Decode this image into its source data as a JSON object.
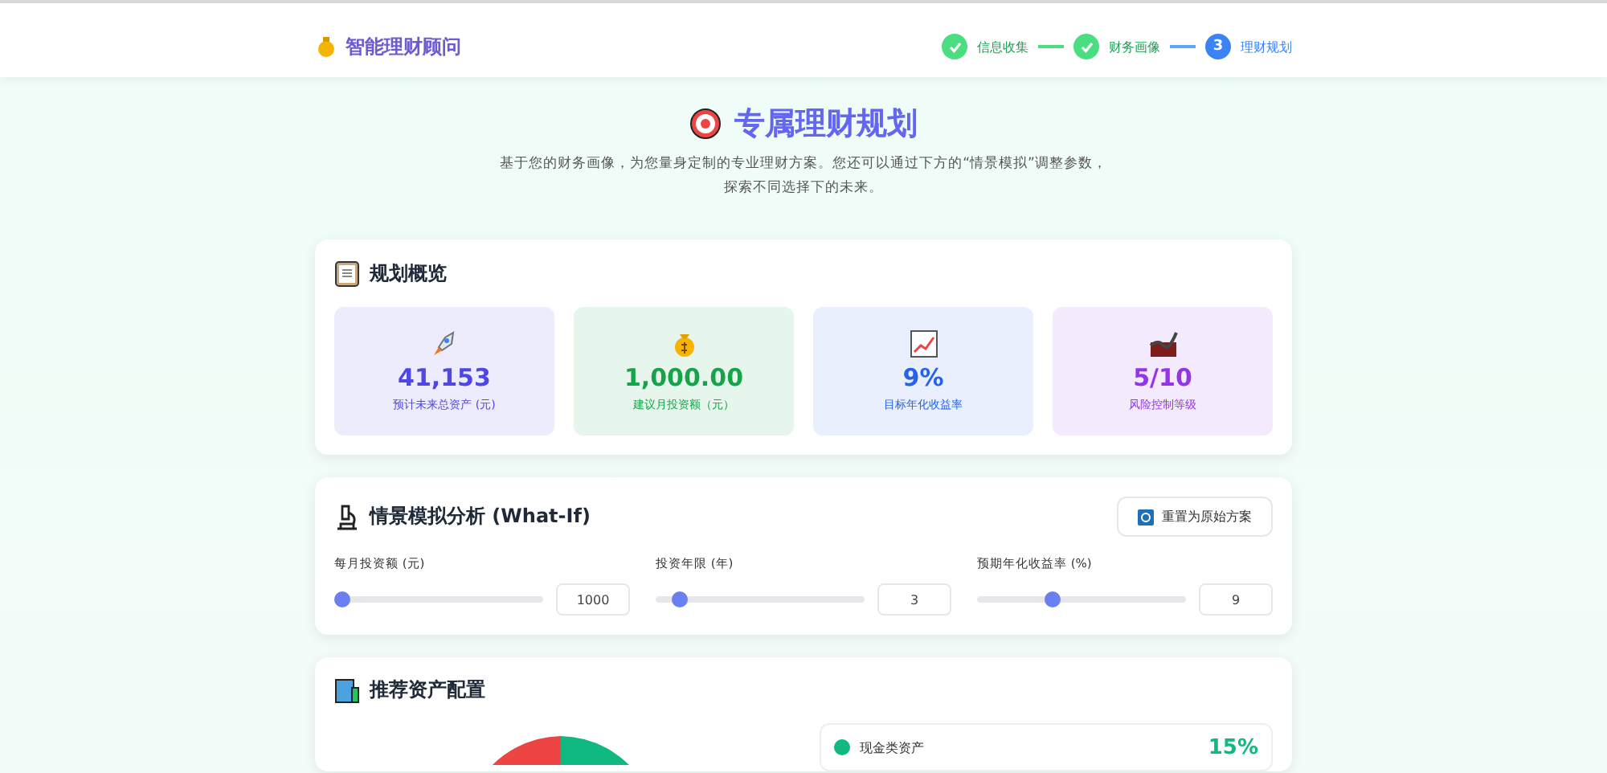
{
  "header": {
    "brand": "智能理财顾问",
    "steps": [
      {
        "label": "信息收集",
        "done": true
      },
      {
        "label": "财务画像",
        "done": true
      },
      {
        "number": "3",
        "label": "理财规划",
        "done": false
      }
    ]
  },
  "hero": {
    "title": "专属理财规划",
    "subtitle": "基于您的财务画像，为您量身定制的专业理财方案。您还可以通过下方的“情景模拟”调整参数，探索不同选择下的未来。"
  },
  "overview": {
    "title": "规划概览",
    "metrics": [
      {
        "value": "41,153",
        "label": "预计未来总资产 (元)",
        "color": "#4f46e5"
      },
      {
        "value": "1,000.00",
        "label": "建议月投资额（元）",
        "color": "#16a34a"
      },
      {
        "value": "9%",
        "label": "目标年化收益率",
        "color": "#2563eb"
      },
      {
        "value": "5/10",
        "label": "风险控制等级",
        "color": "#9333ea"
      }
    ]
  },
  "whatif": {
    "title": "情景模拟分析 (What-If)",
    "reset_button": "重置为原始方案",
    "sliders": [
      {
        "label": "每月投资额 (元)",
        "value": "1000",
        "level": 0.0
      },
      {
        "label": "投资年限 (年)",
        "value": "3",
        "level": 0.08
      },
      {
        "label": "预期年化收益率 (%)",
        "value": "9",
        "level": 0.35
      }
    ]
  },
  "allocation": {
    "title": "推荐资产配置",
    "legend": [
      {
        "name": "现金类资产",
        "percent": "15%",
        "color": "#10b981"
      }
    ]
  }
}
